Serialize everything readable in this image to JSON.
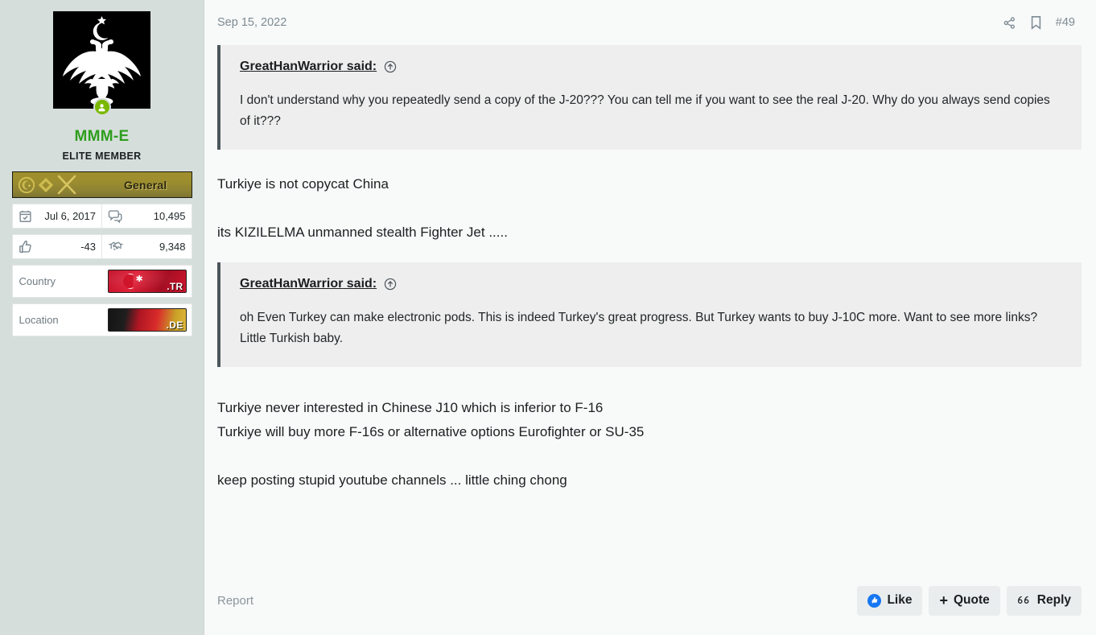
{
  "sidebar": {
    "avatar_alt": "double-headed-eagle-emblem",
    "online_status": "online",
    "username": "MMM-E",
    "user_title": "ELITE MEMBER",
    "rank": {
      "label": "General"
    },
    "stats": [
      {
        "icon": "calendar-check-icon",
        "label": "Joined date",
        "value": "Jul 6, 2017"
      },
      {
        "icon": "messages-icon",
        "label": "Messages",
        "value": "10,495"
      },
      {
        "icon": "thumbs-up-icon",
        "label": "Reaction score",
        "value": "-43"
      },
      {
        "icon": "handshake-icon",
        "label": "Points",
        "value": "9,348"
      }
    ],
    "info": [
      {
        "label": "Country",
        "flag": "turkey-flag",
        "tld": ".TR"
      },
      {
        "label": "Location",
        "flag": "germany-flag",
        "tld": ".DE"
      }
    ]
  },
  "header": {
    "date": "Sep 15, 2022",
    "share_icon": "share-icon",
    "bookmark_icon": "bookmark-icon",
    "post_number": "#49"
  },
  "content": {
    "quote_1": {
      "author": "GreatHanWarrior",
      "said_suffix": " said:",
      "jump_icon": "jump-to-post-arrow-icon",
      "text": "I don't understand why you repeatedly send a copy of the J-20??? You can tell me if you want to see the real J-20. Why do you always send copies of it???"
    },
    "body_1_line_1": "Turkiye is not copycat China",
    "body_1_line_2": "its KIZILELMA unmanned stealth Fighter Jet .....",
    "quote_2": {
      "author": "GreatHanWarrior",
      "said_suffix": " said:",
      "jump_icon": "jump-to-post-arrow-icon",
      "text": "oh Even Turkey can make electronic pods. This is indeed Turkey's great progress. But Turkey wants to buy J-10C more. Want to see more links? Little Turkish baby."
    },
    "body_2_line_1": "Turkiye never interested in Chinese J10 which is inferior to F-16",
    "body_2_line_2": "Turkiye will buy more F-16s or alternative options Eurofighter or SU-35",
    "body_2_line_3": "keep posting stupid youtube channels ... little ching chong"
  },
  "footer": {
    "report_label": "Report",
    "like_label": "Like",
    "quote_label": "Quote",
    "quote_plus": "+",
    "reply_label": "Reply"
  },
  "colors": {
    "username": "#2f9e1e",
    "sidebar_bg": "#d6dedb",
    "main_bg": "#f8f9f9",
    "quote_bg": "#eeeeee",
    "quote_border": "#4c575c",
    "like_blue": "#1877f2",
    "muted_text": "#7d8b93"
  }
}
